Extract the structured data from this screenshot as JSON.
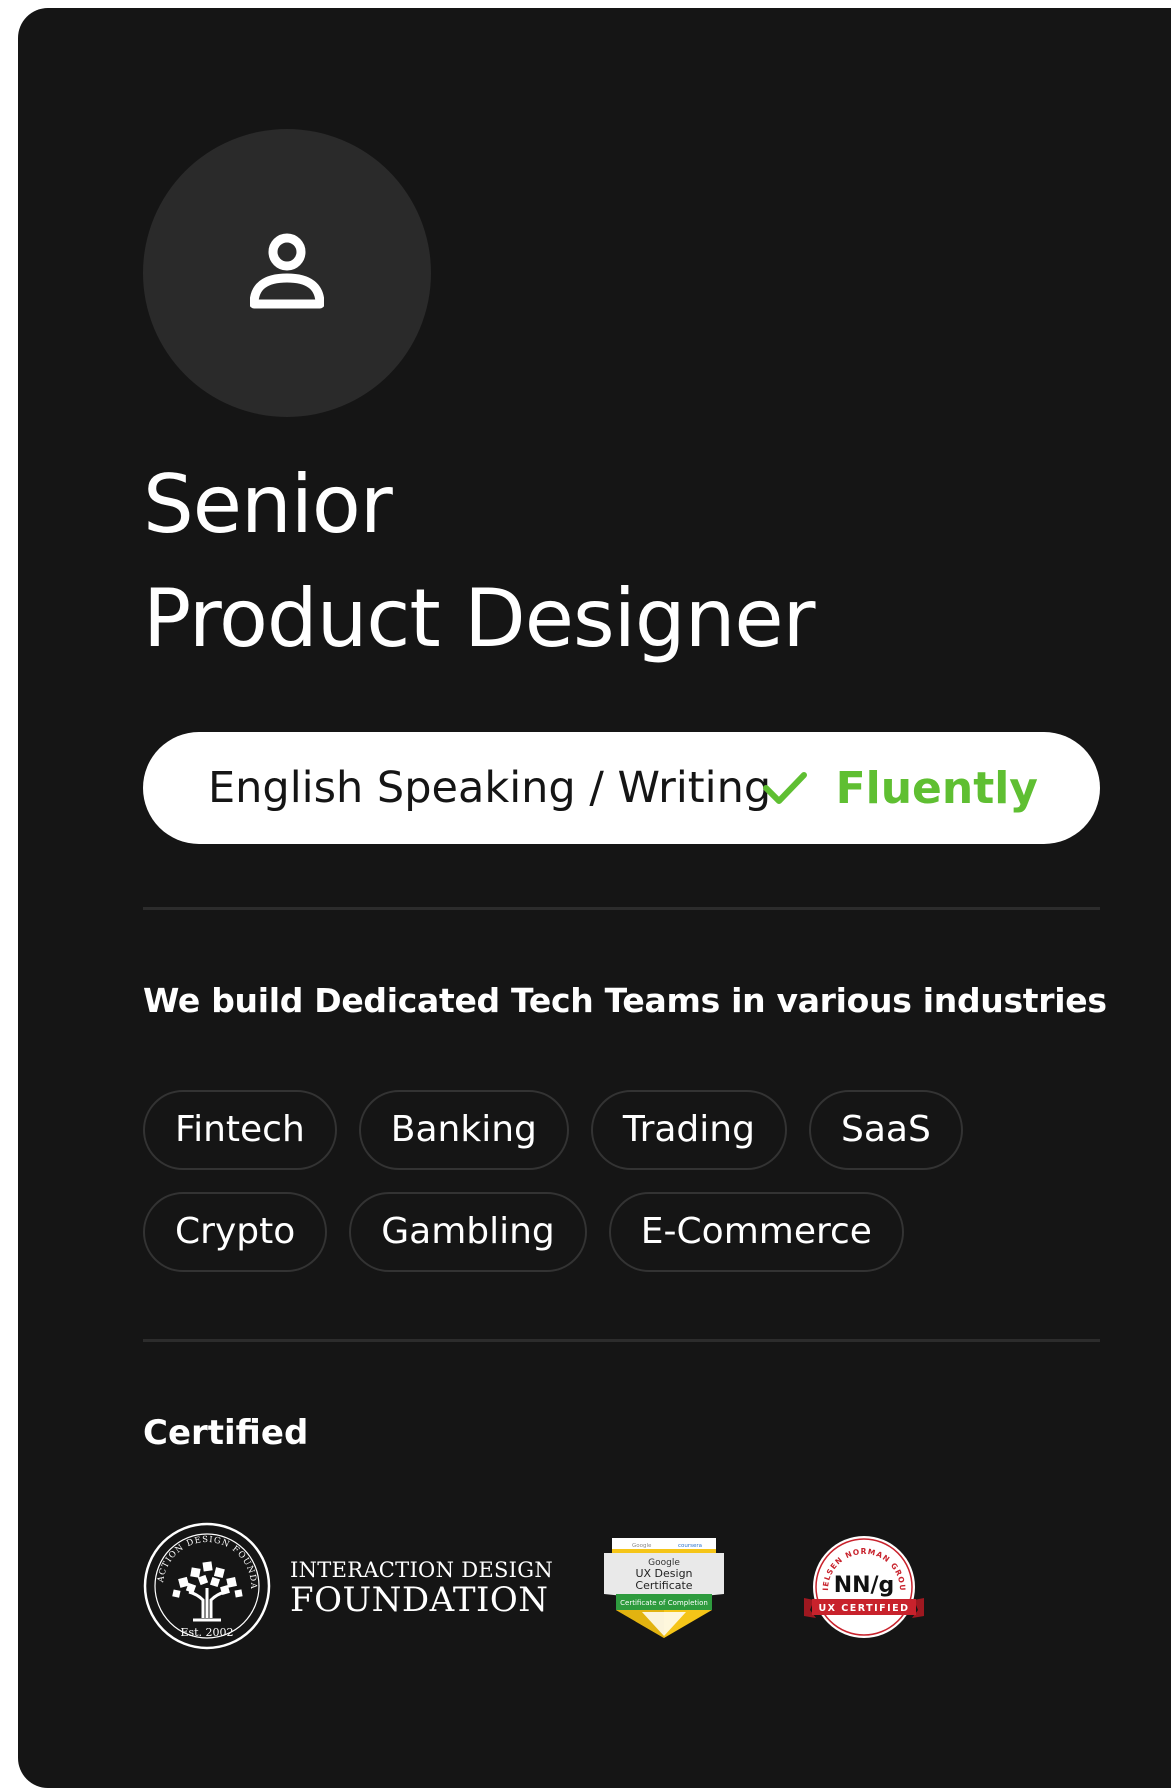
{
  "profile": {
    "title_line1": "Senior",
    "title_line2": "Product Designer",
    "avatar_icon": "user-icon"
  },
  "language": {
    "label": "English Speaking / Writing",
    "status": "Fluently",
    "status_icon": "check-icon",
    "status_color": "#5fbf32"
  },
  "industries": {
    "heading": "We build Dedicated Tech Teams in various industries",
    "tags": [
      "Fintech",
      "Banking",
      "Trading",
      "SaaS",
      "Crypto",
      "Gambling",
      "E-Commerce"
    ]
  },
  "certifications": {
    "heading": "Certified",
    "items": [
      {
        "name": "interaction-design-foundation",
        "line1": "INTERACTION DESIGN",
        "line2": "FOUNDATION",
        "seal_text": "INTERACTION DESIGN FOUNDATION",
        "seal_year": "Est. 2002"
      },
      {
        "name": "google-ux-design-certificate",
        "brand_left": "Google",
        "brand_right": "coursera",
        "line1": "Google",
        "line2": "UX Design",
        "line3": "Certificate",
        "ribbon": "Certificate of Completion"
      },
      {
        "name": "nng-ux-certified",
        "ring_text": "NIELSEN NORMAN GROUP",
        "logo": "NN/g",
        "ribbon": "UX CERTIFIED"
      }
    ]
  },
  "colors": {
    "background": "#151515",
    "avatar_bg": "#2a2a2a",
    "divider": "#2c2c2c",
    "pill_bg": "#ffffff",
    "accent_green": "#5fbf32",
    "nng_red": "#c8222c",
    "google_yellow": "#f5c518",
    "google_green": "#2e9b3e"
  }
}
